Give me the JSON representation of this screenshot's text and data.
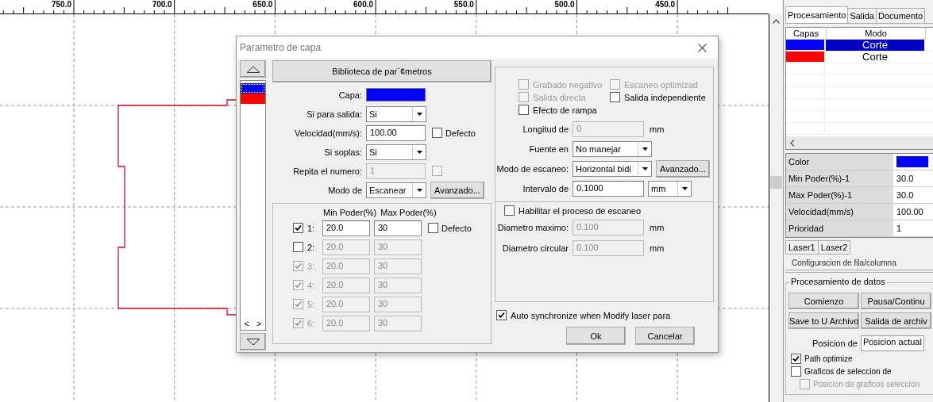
{
  "ruler": {
    "labels": [
      "750.0",
      "700.0",
      "650.0",
      "600.0",
      "550.0",
      "500.0",
      "450.0"
    ]
  },
  "dialog": {
    "title": "Parametro de capa",
    "layers": [
      {
        "color": "#0000ff",
        "selected": true
      },
      {
        "color": "#ff0000",
        "selected": false
      }
    ],
    "list_scroll": [
      "<",
      ">"
    ],
    "library_button": "Biblioteca de par¨¢metros",
    "fields": [
      {
        "kind": "color",
        "label": "Capa:",
        "color": "#0000ff"
      },
      {
        "kind": "select",
        "label": "Si para salida:",
        "value": "Si"
      },
      {
        "kind": "input",
        "label": "Velocidad(mm/s):",
        "value": "100.00",
        "disabled": false,
        "checkbox": {
          "label": "Defecto",
          "checked": false,
          "disabled": false
        }
      },
      {
        "kind": "select",
        "label": "Si soplas:",
        "value": "Si"
      },
      {
        "kind": "input",
        "label": "Repita el numero:",
        "value": "1",
        "disabled": true,
        "checkbox": {
          "checked": false,
          "disabled": true
        }
      },
      {
        "kind": "select",
        "label": "Modo de",
        "value": "Escanear",
        "button": "Avanzado..."
      }
    ],
    "power": {
      "min_header": "Min Poder(%)",
      "max_header": "Max Poder(%)",
      "default": {
        "label": "Defecto",
        "checked": false
      },
      "rows": [
        {
          "label": "1:",
          "checked": true,
          "disabled": false,
          "min": "20.0",
          "max": "30"
        },
        {
          "label": "2:",
          "checked": false,
          "disabled": false,
          "min": "20.0",
          "max": "30"
        },
        {
          "label": "3:",
          "checked": true,
          "disabled": true,
          "min": "20.0",
          "max": "30"
        },
        {
          "label": "4:",
          "checked": true,
          "disabled": true,
          "min": "20.0",
          "max": "30"
        },
        {
          "label": "5:",
          "checked": true,
          "disabled": true,
          "min": "20.0",
          "max": "30"
        },
        {
          "label": "6:",
          "checked": true,
          "disabled": true,
          "min": "20.0",
          "max": "30"
        }
      ]
    },
    "options": [
      {
        "label": "Grabado negativo",
        "checked": false,
        "disabled": true
      },
      {
        "label": "Escaneo optimizad",
        "checked": false,
        "disabled": true
      },
      {
        "label": "Salida directa",
        "checked": false,
        "disabled": true
      },
      {
        "label": "Salida independiente",
        "checked": false,
        "disabled": false
      },
      {
        "label": "Efecto de rampa",
        "checked": false,
        "disabled": false
      }
    ],
    "scan_fields": [
      {
        "kind": "input",
        "label": "Longitud de",
        "value": "0",
        "disabled": true,
        "unit": "mm"
      },
      {
        "kind": "select",
        "label": "Fuente en",
        "value": "No manejar"
      },
      {
        "kind": "select",
        "label": "Modo de escaneo:",
        "value": "Horizontal bidi",
        "button": "Avanzado..."
      },
      {
        "kind": "input",
        "label": "Intervalo de",
        "value": "0.1000",
        "disabled": false,
        "unit_select": "mm"
      }
    ],
    "scan_process": {
      "label": "Habilitar el proceso de escaneo",
      "checked": false
    },
    "diameter_fields": [
      {
        "kind": "input",
        "label": "Diametro maximo:",
        "value": "0.100",
        "disabled": true,
        "unit": "mm"
      },
      {
        "kind": "input",
        "label": "Diametro circular",
        "value": "0.100",
        "disabled": true,
        "unit": "mm"
      }
    ],
    "auto_sync": {
      "label": "Auto synchronize when Modify laser para",
      "checked": true
    },
    "buttons": [
      "Ok",
      "Cancelar"
    ]
  },
  "panel": {
    "tabs": [
      {
        "label": "Procesamiento",
        "selected": true
      },
      {
        "label": "Salida",
        "selected": false
      },
      {
        "label": "Documento",
        "selected": false
      }
    ],
    "table": {
      "columns": [
        "Capas",
        "Modo"
      ],
      "rows": [
        {
          "color": "#0000ff",
          "mode": "Corte",
          "selected": true
        },
        {
          "color": "#ff0000",
          "mode": "Corte",
          "selected": false
        }
      ]
    },
    "properties": [
      {
        "kind": "color",
        "label": "Color",
        "color": "#0000ff"
      },
      {
        "kind": "text",
        "label": "Min Poder(%)-1",
        "value": "30.0"
      },
      {
        "kind": "text",
        "label": "Max Poder(%)-1",
        "value": "30.0"
      },
      {
        "kind": "text",
        "label": "Velocidad(mm/s)",
        "value": "100.00"
      },
      {
        "kind": "text",
        "label": "Prioridad",
        "value": "1"
      }
    ],
    "laser_tabs": [
      "Laser1",
      "Laser2"
    ],
    "row_column_group": "Configuracion de fila/columna",
    "data_group": {
      "title": "Procesamiento de datos",
      "buttons": [
        "Comienzo",
        "Pausa/Continu",
        "Save to U Archivo",
        "Salida de archiv"
      ],
      "position_label": "Posicion de",
      "position_value": "Posicion actual",
      "checks": [
        {
          "label": "Path optimize",
          "checked": true,
          "disabled": false,
          "indent": false
        },
        {
          "label": "Graficos de seleccion de",
          "checked": false,
          "disabled": false,
          "indent": false
        },
        {
          "label": "Posicion de graficos seleccion",
          "checked": false,
          "disabled": true,
          "indent": true
        }
      ]
    }
  }
}
